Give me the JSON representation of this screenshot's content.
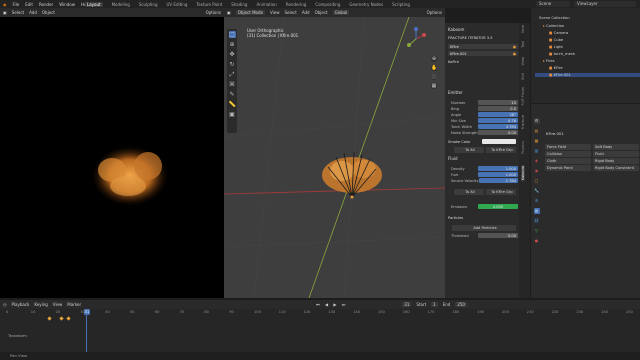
{
  "menu": [
    "File",
    "Edit",
    "Render",
    "Window",
    "Help"
  ],
  "workspaces": [
    "Layout",
    "Modeling",
    "Sculpting",
    "UV Editing",
    "Texture Paint",
    "Shading",
    "Animation",
    "Rendering",
    "Compositing",
    "Geometry Nodes",
    "Scripting"
  ],
  "scene": "Scene",
  "view_layer": "ViewLayer",
  "left_header": {
    "items": [
      "Select",
      "Add",
      "Object"
    ],
    "mode": "Object Mode",
    "options": "Options"
  },
  "mid_header": {
    "mode": "Object Mode",
    "items": [
      "View",
      "Select",
      "Add",
      "Object"
    ],
    "global": "Global",
    "options": "Options"
  },
  "viewport": {
    "view_name": "User Orthographic",
    "collection": "(31) Collection | Kfire.001"
  },
  "npanel": {
    "title": "Kaboom",
    "addon": "FRACTURE ITERATOR 3.5",
    "obj1": "KFire",
    "obj2": "KFire.001",
    "kaf": "KaFire",
    "emitter": "Emitter",
    "rows": [
      {
        "label": "Number",
        "value": "15"
      },
      {
        "label": "Bing",
        "value": "0.5"
      },
      {
        "label": "Angle",
        "value": "28°"
      },
      {
        "label": "Min Size",
        "value": "0.76"
      },
      {
        "label": "Torch Width",
        "value": "3.784"
      },
      {
        "label": "Noise Strength",
        "value": "0.00"
      }
    ],
    "smoke_color": "Smoke Color",
    "to_all": "To All",
    "to_kfire": "To KFire Grp",
    "fluid": "Fluid",
    "fluid_rows": [
      {
        "label": "Density",
        "value": "1.000"
      },
      {
        "label": "Fuel",
        "value": "1.000"
      },
      {
        "label": "Source Velocity",
        "value": "1.784"
      }
    ],
    "emission_label": "Emission",
    "emission_value": "0.000",
    "particles": "Particles",
    "add_particles": "Add Particles",
    "threshold_label": "Threshold",
    "threshold_value": "0.00"
  },
  "ntabs": [
    "Item",
    "Tool",
    "View",
    "Edit",
    "FLIP Fluids",
    "Fracture",
    "Physics",
    "Kaboom"
  ],
  "outliner": {
    "title": "Scene Collection",
    "items": [
      "Collection",
      "Camera",
      "Cube",
      "Light",
      "torch_mesh",
      "Fires",
      "KFire",
      "KFire.001"
    ]
  },
  "properties": {
    "object": "KFire.001",
    "buttons": [
      "Force Field",
      "Collision",
      "Cloth",
      "Dynamic Paint",
      "Soft Body",
      "Fluid",
      "Rigid Body",
      "Rigid Body Constraint"
    ]
  },
  "timeline": {
    "items": [
      "Playback",
      "Keying",
      "View",
      "Marker"
    ],
    "current_frame": "31",
    "start_label": "Start",
    "start": "1",
    "end_label": "End",
    "end": "250",
    "ticks": [
      "0",
      "10",
      "20",
      "30",
      "40",
      "50",
      "60",
      "70",
      "80",
      "90",
      "100",
      "110",
      "120",
      "130",
      "140",
      "150",
      "160",
      "170",
      "180",
      "190",
      "200",
      "210",
      "220",
      "230",
      "240",
      "250"
    ]
  },
  "transform_label": "Transform",
  "status": "Pan View",
  "colors": {
    "accent": "#4772b3",
    "emission": "#2fa84f",
    "fire": "#e08a2a",
    "axis_red": "#a83a3a",
    "axis_green": "#8aa83a"
  }
}
